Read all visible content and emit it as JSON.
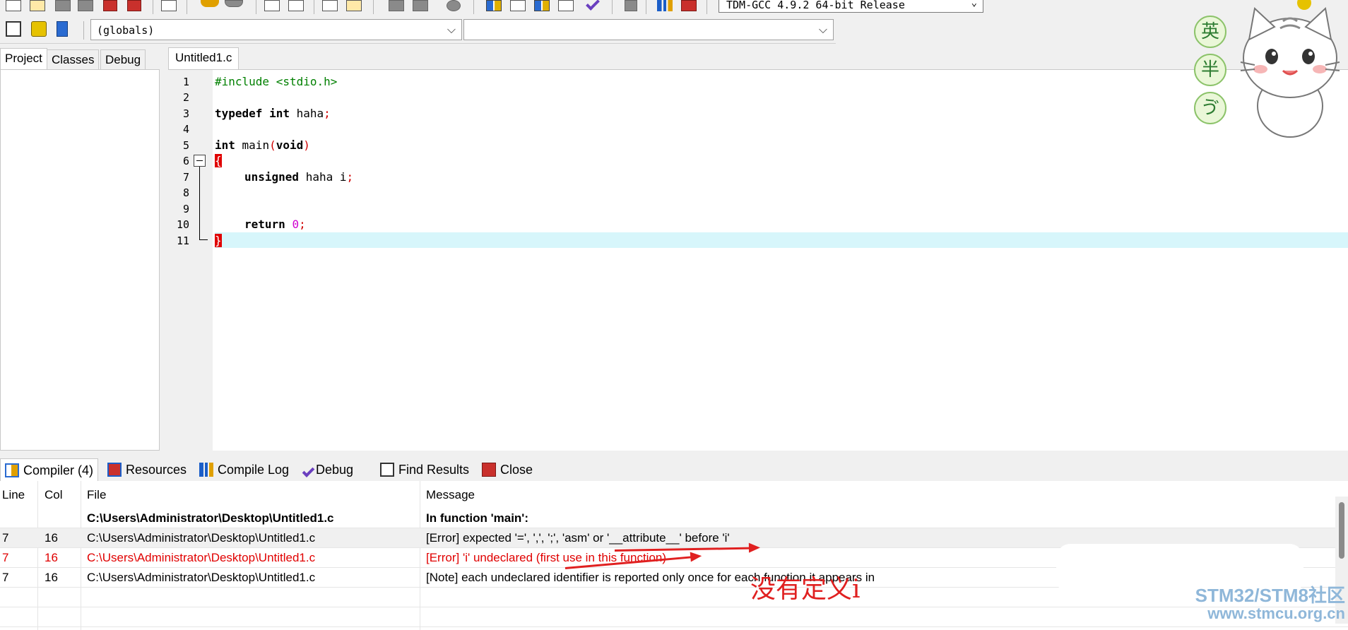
{
  "toolbar": {
    "compiler": "TDM-GCC 4.9.2 64-bit Release"
  },
  "toolbar2": {
    "scope_select": "(globals)",
    "member_select": ""
  },
  "left_panel": {
    "tabs": [
      "Project",
      "Classes",
      "Debug"
    ]
  },
  "editor": {
    "tab": "Untitled1.c",
    "lines": [
      {
        "num": "1"
      },
      {
        "num": "2"
      },
      {
        "num": "3"
      },
      {
        "num": "4"
      },
      {
        "num": "5"
      },
      {
        "num": "6"
      },
      {
        "num": "7"
      },
      {
        "num": "8"
      },
      {
        "num": "9"
      },
      {
        "num": "10"
      },
      {
        "num": "11"
      }
    ],
    "code": {
      "l1": "#include <stdio.h>",
      "l3_kw": "typedef int",
      "l3_id": " haha",
      "l3_p": ";",
      "l5_kw": "int",
      "l5_id": " main",
      "l5_p1": "(",
      "l5_kw2": "void",
      "l5_p2": ")",
      "l6": "{",
      "l7_kw": "unsigned",
      "l7_id": " haha i",
      "l7_p": ";",
      "l10_kw": "return",
      "l10_num": "0",
      "l10_p": ";",
      "l11": "}"
    }
  },
  "bottom_tabs": {
    "compiler": "Compiler (4)",
    "resources": "Resources",
    "compile_log": "Compile Log",
    "debug": "Debug",
    "find_results": "Find Results",
    "close": "Close"
  },
  "messages": {
    "headers": {
      "line": "Line",
      "col": "Col",
      "file": "File",
      "message": "Message"
    },
    "rows": [
      {
        "line": "",
        "col": "",
        "file": "C:\\Users\\Administrator\\Desktop\\Untitled1.c",
        "message": "In function 'main':"
      },
      {
        "line": "7",
        "col": "16",
        "file": "C:\\Users\\Administrator\\Desktop\\Untitled1.c",
        "message": "[Error] expected '=', ',', ';', 'asm' or '__attribute__' before 'i'"
      },
      {
        "line": "7",
        "col": "16",
        "file": "C:\\Users\\Administrator\\Desktop\\Untitled1.c",
        "message": "[Error] 'i' undeclared (first use in this function)"
      },
      {
        "line": "7",
        "col": "16",
        "file": "C:\\Users\\Administrator\\Desktop\\Untitled1.c",
        "message": "[Note] each undeclared identifier is reported only once for each function it appears in"
      }
    ]
  },
  "annotation": "没有定义i",
  "watermark": {
    "line1": "STM32/STM8社区",
    "line2": "www.stmcu.org.cn"
  },
  "mascot": {
    "badges": [
      "英",
      "半",
      "ゔ"
    ]
  },
  "colors": {
    "error": "#e00000",
    "current_line": "#d7f6fb",
    "annotation": "#e02020",
    "watermark": "#8fb7d9"
  }
}
